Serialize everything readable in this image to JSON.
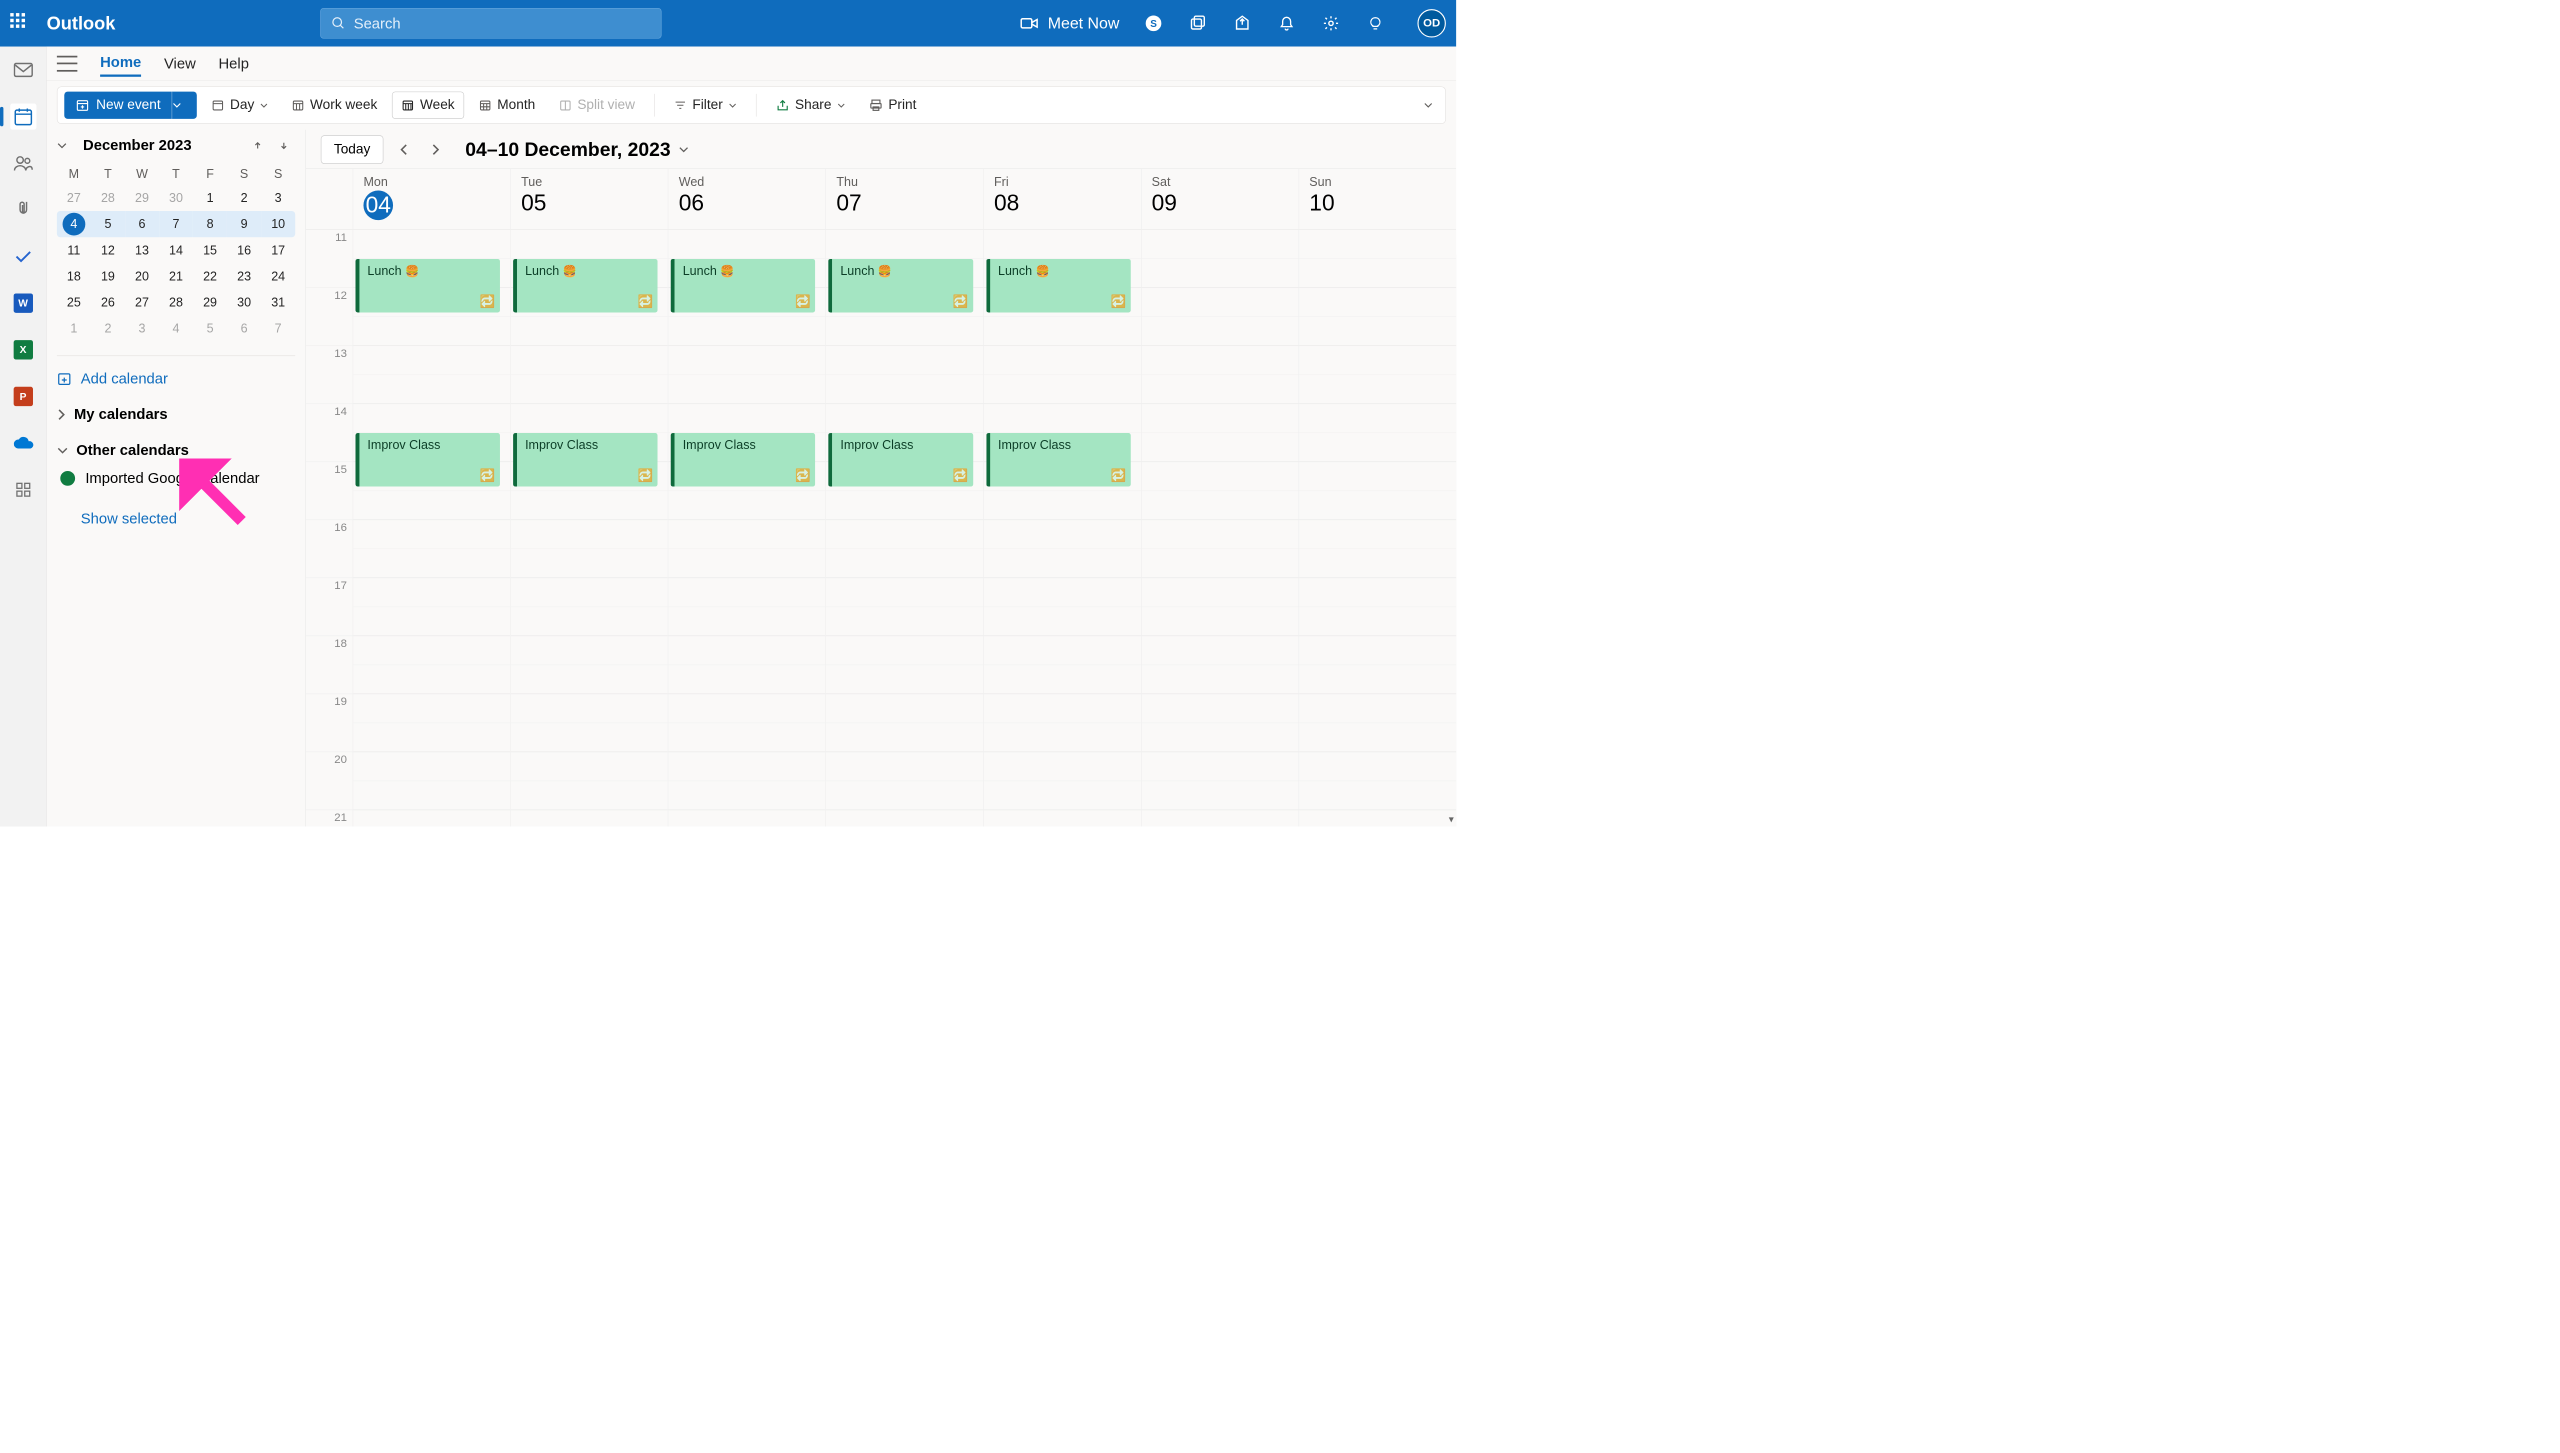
{
  "brand": "Outlook",
  "search_placeholder": "Search",
  "meet_now": "Meet Now",
  "avatar": "OD",
  "tabs": {
    "home": "Home",
    "view": "View",
    "help": "Help"
  },
  "toolbar": {
    "new_event": "New event",
    "day": "Day",
    "work_week": "Work week",
    "week": "Week",
    "month": "Month",
    "split_view": "Split view",
    "filter": "Filter",
    "share": "Share",
    "print": "Print"
  },
  "mini": {
    "title": "December 2023",
    "dow": [
      "M",
      "T",
      "W",
      "T",
      "F",
      "S",
      "S"
    ],
    "rows": [
      [
        {
          "n": "27",
          "o": true
        },
        {
          "n": "28",
          "o": true
        },
        {
          "n": "29",
          "o": true
        },
        {
          "n": "30",
          "o": true
        },
        {
          "n": "1"
        },
        {
          "n": "2"
        },
        {
          "n": "3"
        }
      ],
      [
        {
          "n": "4",
          "today": true,
          "range": "first"
        },
        {
          "n": "5",
          "range": "mid"
        },
        {
          "n": "6",
          "range": "mid"
        },
        {
          "n": "7",
          "range": "mid"
        },
        {
          "n": "8",
          "range": "mid"
        },
        {
          "n": "9",
          "range": "mid"
        },
        {
          "n": "10",
          "range": "last"
        }
      ],
      [
        {
          "n": "11"
        },
        {
          "n": "12"
        },
        {
          "n": "13"
        },
        {
          "n": "14"
        },
        {
          "n": "15"
        },
        {
          "n": "16"
        },
        {
          "n": "17"
        }
      ],
      [
        {
          "n": "18"
        },
        {
          "n": "19"
        },
        {
          "n": "20"
        },
        {
          "n": "21"
        },
        {
          "n": "22"
        },
        {
          "n": "23"
        },
        {
          "n": "24"
        }
      ],
      [
        {
          "n": "25"
        },
        {
          "n": "26"
        },
        {
          "n": "27"
        },
        {
          "n": "28"
        },
        {
          "n": "29"
        },
        {
          "n": "30"
        },
        {
          "n": "31"
        }
      ],
      [
        {
          "n": "1",
          "o": true
        },
        {
          "n": "2",
          "o": true
        },
        {
          "n": "3",
          "o": true
        },
        {
          "n": "4",
          "o": true
        },
        {
          "n": "5",
          "o": true
        },
        {
          "n": "6",
          "o": true
        },
        {
          "n": "7",
          "o": true
        }
      ]
    ]
  },
  "sidebar": {
    "add_calendar": "Add calendar",
    "my_calendars": "My calendars",
    "other_calendars": "Other calendars",
    "imported": "Imported Google Calendar",
    "show_selected": "Show selected"
  },
  "calhdr": {
    "today": "Today",
    "range": "04–10 December, 2023"
  },
  "days": [
    {
      "dow": "Mon",
      "dn": "04",
      "today": true
    },
    {
      "dow": "Tue",
      "dn": "05"
    },
    {
      "dow": "Wed",
      "dn": "06"
    },
    {
      "dow": "Thu",
      "dn": "07"
    },
    {
      "dow": "Fri",
      "dn": "08"
    },
    {
      "dow": "Sat",
      "dn": "09"
    },
    {
      "dow": "Sun",
      "dn": "10"
    }
  ],
  "hours": [
    "11",
    "12",
    "13",
    "14",
    "15",
    "16",
    "17",
    "18",
    "19",
    "20",
    "21"
  ],
  "events": {
    "lunch": {
      "title": "Lunch",
      "emoji": "🍔"
    },
    "improv": {
      "title": "Improv Class"
    }
  }
}
